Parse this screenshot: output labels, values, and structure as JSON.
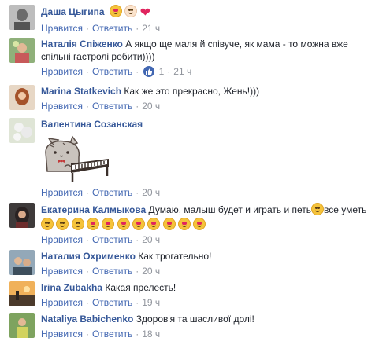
{
  "labels": {
    "like": "Нравится",
    "reply": "Ответить",
    "dot": "·"
  },
  "comments": [
    {
      "author": "Даша Цыгипа",
      "text": "",
      "reactions": "",
      "time": "21 ч",
      "emojis": [
        "heart-eyes",
        "baby",
        "heart"
      ]
    },
    {
      "author": "Наталія Спіженко",
      "text": "А якщо ще маля й співуче, як мама - то можна вже спільні гастролі робити))))",
      "reactions": "1",
      "time": "21 ч",
      "text_line1": "А якщо ще маля й співуче, як мама - то можна вже",
      "text_line2": "спільні гастролі робити))))"
    },
    {
      "author": "Marina Statkevich",
      "text": "Как же это прекрасно, Жень!)))",
      "time": "20 ч"
    },
    {
      "author": "Валентина Созанская",
      "text": "",
      "time": "20 ч",
      "sticker": "pusheen-piano-cat"
    },
    {
      "author": "Екатерина Калмыкова",
      "text": "Думаю, малыш будет и играть и петь",
      "text_after": "все уметь",
      "time": "20 ч",
      "emoji_row": [
        "smile",
        "smile",
        "smile",
        "heart-eyes",
        "heart-eyes",
        "heart-eyes",
        "heart-eyes",
        "heart-eyes",
        "heart-eyes",
        "heart-eyes",
        "heart-eyes"
      ]
    },
    {
      "author": "Наталия Охрименко",
      "text": "Как трогательно!",
      "time": "20 ч"
    },
    {
      "author": "Irina Zubakha",
      "text": "Какая прелесть!",
      "time": "19 ч"
    },
    {
      "author": "Nataliya Babichenko",
      "text": "Здоров'я та шасливої долі!",
      "time": "18 ч"
    }
  ],
  "colors": {
    "link": "#365899",
    "action": "#4267b2",
    "meta": "#90949c",
    "text": "#1d2129"
  }
}
